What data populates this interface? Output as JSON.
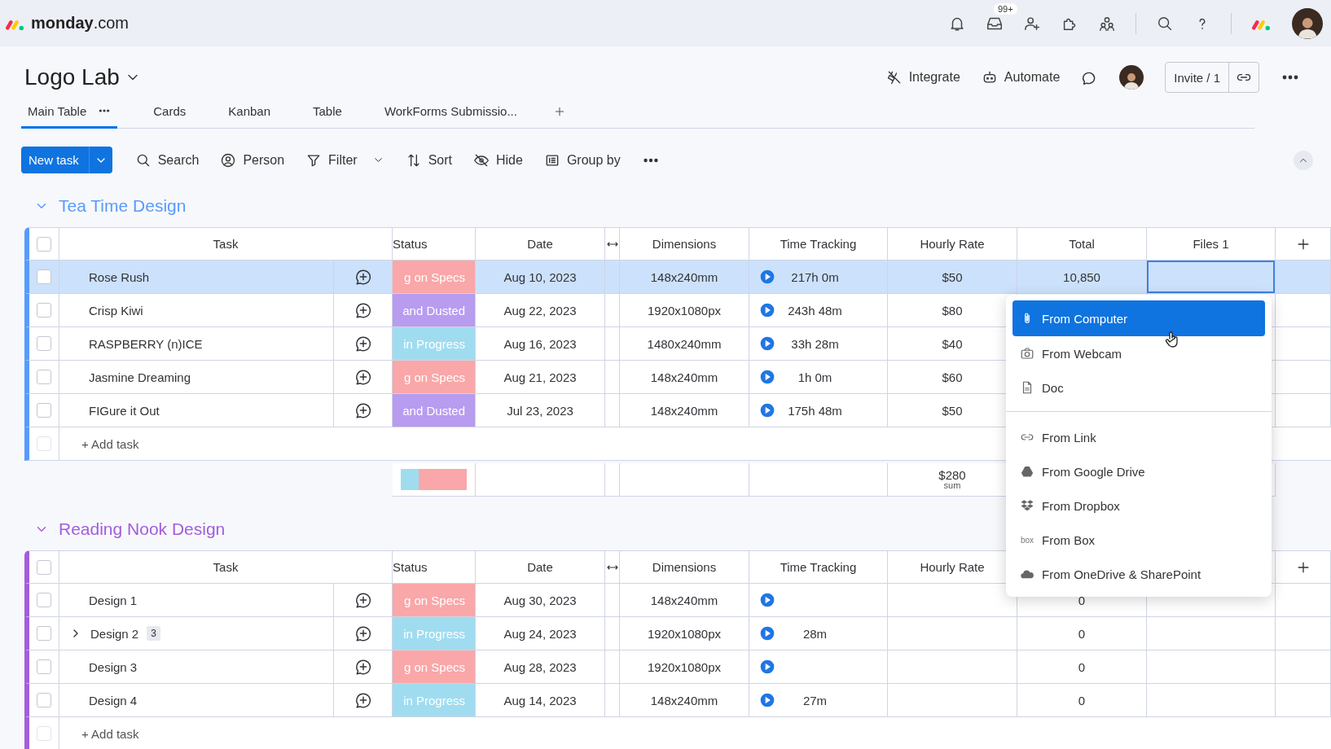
{
  "topbar": {
    "brand": "monday",
    "brand_suffix": ".com",
    "inbox_badge": "99+"
  },
  "board": {
    "title": "Logo Lab",
    "actions": [
      {
        "label": "Integrate",
        "kind": "integrate"
      },
      {
        "label": "Automate",
        "kind": "automate"
      }
    ],
    "invite": "Invite / 1"
  },
  "views": [
    {
      "label": "Main Table",
      "selected": true
    },
    {
      "label": "Cards",
      "selected": false
    },
    {
      "label": "Kanban",
      "selected": false
    },
    {
      "label": "Table",
      "selected": false
    },
    {
      "label": "WorkForms Submissio...",
      "selected": false
    }
  ],
  "toolbar": {
    "new_task": "New task",
    "items": [
      {
        "label": "Search",
        "kind": "search",
        "dropdown": false
      },
      {
        "label": "Person",
        "kind": "person",
        "dropdown": false
      },
      {
        "label": "Filter",
        "kind": "filter",
        "dropdown": true
      },
      {
        "label": "Sort",
        "kind": "sort",
        "dropdown": false
      },
      {
        "label": "Hide",
        "kind": "hide",
        "dropdown": false
      },
      {
        "label": "Group by",
        "kind": "group",
        "dropdown": false
      }
    ]
  },
  "groups": [
    {
      "title": "Tea Time Design",
      "color": "#579bfc",
      "all_checked": false,
      "add_row_checked": false,
      "columns": [
        "Task",
        "Status",
        "Date",
        "Dimensions",
        "Time Tracking",
        "Hourly Rate",
        "Total",
        "Files 1"
      ],
      "rows": [
        {
          "task": "Rose Rush",
          "selected": true,
          "checked": false,
          "status": {
            "label": "g on Specs",
            "color": "#f9a7a8"
          },
          "date": "Aug 10, 2023",
          "dimensions": "148x240mm",
          "time": "217h 0m",
          "rate": "$50",
          "total": "10,850"
        },
        {
          "task": "Crisp Kiwi",
          "selected": false,
          "checked": false,
          "status": {
            "label": "and Dusted",
            "color": "#b79cf0"
          },
          "date": "Aug 22, 2023",
          "dimensions": "1920x1080px",
          "time": "243h 48m",
          "rate": "$80"
        },
        {
          "task": "RASPBERRY (n)ICE",
          "selected": false,
          "checked": false,
          "status": {
            "label": "in Progress",
            "color": "#a0dcf0"
          },
          "date": "Aug 16, 2023",
          "dimensions": "1480x240mm",
          "time": "33h 28m",
          "rate": "$40"
        },
        {
          "task": "Jasmine Dreaming",
          "selected": false,
          "checked": false,
          "status": {
            "label": "g on Specs",
            "color": "#f9a7a8"
          },
          "date": "Aug 21, 2023",
          "dimensions": "148x240mm",
          "time": "1h 0m",
          "rate": "$60"
        },
        {
          "task": "FIGure it Out",
          "selected": false,
          "checked": false,
          "status": {
            "label": "and Dusted",
            "color": "#b79cf0"
          },
          "date": "Jul 23, 2023",
          "dimensions": "148x240mm",
          "time": "175h 48m",
          "rate": "$50"
        }
      ],
      "add_task": "+ Add task",
      "summary": {
        "status_segments": [
          {
            "color": "#a0dcf0",
            "level": 0.28
          },
          {
            "color": "#f9a7a8",
            "level": 0.72
          }
        ],
        "rate_sum": "$280",
        "rate_sum_label": "sum"
      }
    },
    {
      "title": "Reading Nook Design",
      "color": "#a25ddc",
      "all_checked": false,
      "add_row_checked": false,
      "columns": [
        "Task",
        "Status",
        "Date",
        "Dimensions",
        "Time Tracking",
        "Hourly Rate"
      ],
      "rows": [
        {
          "task": "Design 1",
          "selected": false,
          "checked": false,
          "status": {
            "label": "g on Specs",
            "color": "#f9a7a8"
          },
          "date": "Aug 30, 2023",
          "dimensions": "148x240mm",
          "total": "0"
        },
        {
          "task": "Design 2",
          "selected": false,
          "checked": false,
          "subitems": "3",
          "expanded": false,
          "status": {
            "label": "in Progress",
            "color": "#a0dcf0"
          },
          "date": "Aug 24, 2023",
          "dimensions": "1920x1080px",
          "time": "28m",
          "total": "0"
        },
        {
          "task": "Design 3",
          "selected": false,
          "checked": false,
          "status": {
            "label": "g on Specs",
            "color": "#f9a7a8"
          },
          "date": "Aug 28, 2023",
          "dimensions": "1920x1080px",
          "total": "0"
        },
        {
          "task": "Design 4",
          "selected": false,
          "checked": false,
          "status": {
            "label": "in Progress",
            "color": "#a0dcf0"
          },
          "date": "Aug 14, 2023",
          "dimensions": "148x240mm",
          "time": "27m",
          "total": "0"
        }
      ],
      "add_task": "+ Add task"
    }
  ],
  "file_menu": {
    "sections": [
      [
        {
          "label": "From Computer",
          "kind": "computer",
          "selected": true
        },
        {
          "label": "From Webcam",
          "kind": "webcam",
          "selected": false
        },
        {
          "label": "Doc",
          "kind": "doc",
          "selected": false
        }
      ],
      [
        {
          "label": "From Link",
          "kind": "link",
          "selected": false
        },
        {
          "label": "From Google Drive",
          "kind": "gdrive",
          "selected": false
        },
        {
          "label": "From Dropbox",
          "kind": "dropbox",
          "selected": false
        },
        {
          "label": "From Box",
          "kind": "box",
          "logo_text": "box",
          "selected": false
        },
        {
          "label": "From OneDrive & SharePoint",
          "kind": "onedrive",
          "selected": false
        }
      ]
    ]
  }
}
